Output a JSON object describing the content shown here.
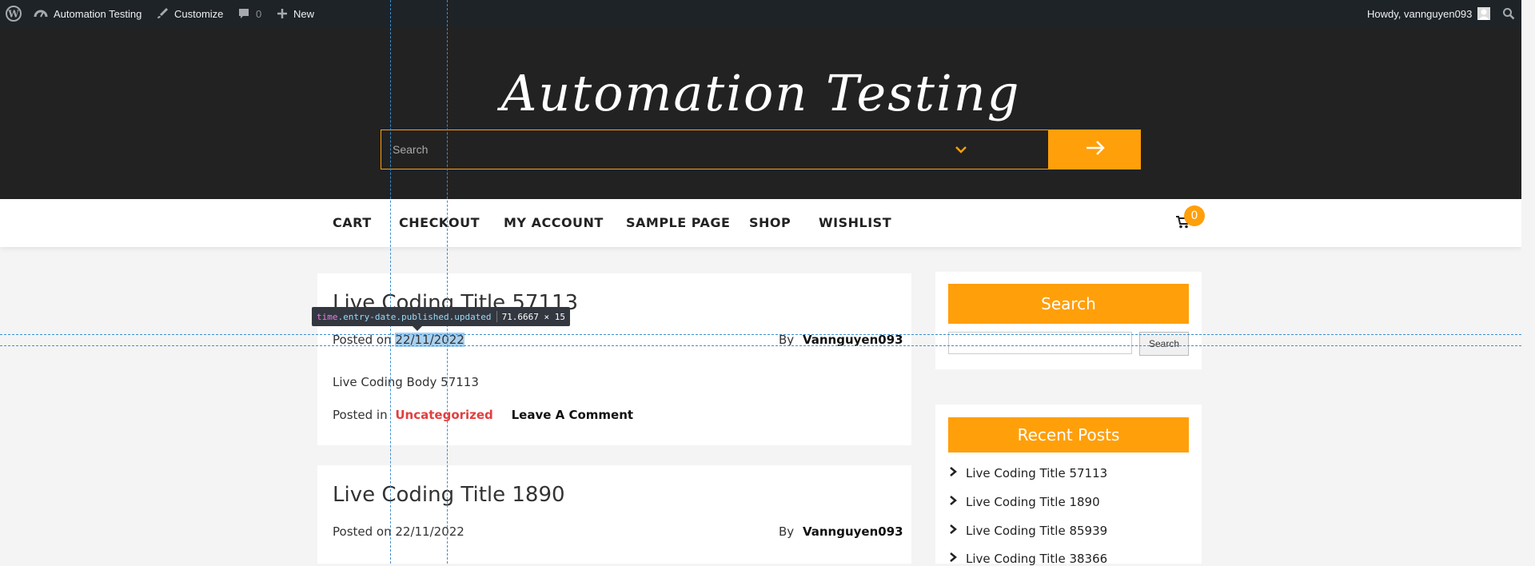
{
  "adminbar": {
    "site_name": "Automation Testing",
    "customize": "Customize",
    "comments_count": "0",
    "new_label": "New",
    "howdy": "Howdy, vannguyen093"
  },
  "header": {
    "site_title": "Automation Testing",
    "search_placeholder": "Search"
  },
  "nav": {
    "items": [
      "CART",
      "CHECKOUT",
      "MY ACCOUNT",
      "SAMPLE PAGE",
      "SHOP",
      "WISHLIST"
    ],
    "cart_count": "0"
  },
  "posts": [
    {
      "title": "Live Coding Title 57113",
      "posted_on_label": "Posted on",
      "date": "22/11/2022",
      "by_label": "By",
      "author": "Vannguyen093",
      "body": "Live Coding Body 57113",
      "posted_in_label": "Posted in",
      "category": "Uncategorized",
      "comment_link": "Leave A Comment"
    },
    {
      "title": "Live Coding Title 1890",
      "posted_on_label": "Posted on",
      "date": "22/11/2022",
      "by_label": "By",
      "author": "Vannguyen093"
    }
  ],
  "sidebar": {
    "search_title": "Search",
    "search_button": "Search",
    "recent_title": "Recent Posts",
    "recent_posts": [
      "Live Coding Title 57113",
      "Live Coding Title 1890",
      "Live Coding Title 85939",
      "Live Coding Title 38366"
    ]
  },
  "inspector": {
    "tag": "time",
    "classes": ".entry-date.published.updated",
    "size": "71.6667 × 15"
  },
  "colors": {
    "accent": "#ff9f0a",
    "header_bg": "#222222",
    "adminbar_bg": "#1d2327",
    "category_red": "#e33e3e"
  }
}
